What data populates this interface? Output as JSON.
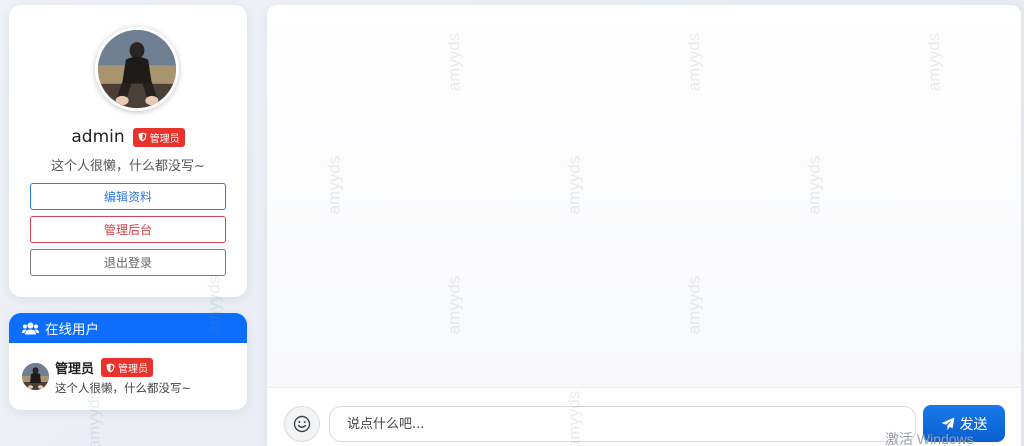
{
  "profile": {
    "username": "admin",
    "role_badge": "管理员",
    "bio": "这个人很懒，什么都没写~",
    "buttons": {
      "edit": "编辑资料",
      "admin": "管理后台",
      "logout": "退出登录"
    }
  },
  "online": {
    "title": "在线用户",
    "users": [
      {
        "name": "管理员",
        "badge": "管理员",
        "bio": "这个人很懒，什么都没写~"
      }
    ]
  },
  "chat": {
    "input_placeholder": "说点什么吧...",
    "send_label": "发送"
  },
  "watermark_text": "amyyds",
  "system_overlay": "激活 Windows",
  "colors": {
    "primary": "#0d6efd",
    "danger": "#e8322b",
    "edit_border": "#2f7be5",
    "admin_border": "#d9424f"
  }
}
